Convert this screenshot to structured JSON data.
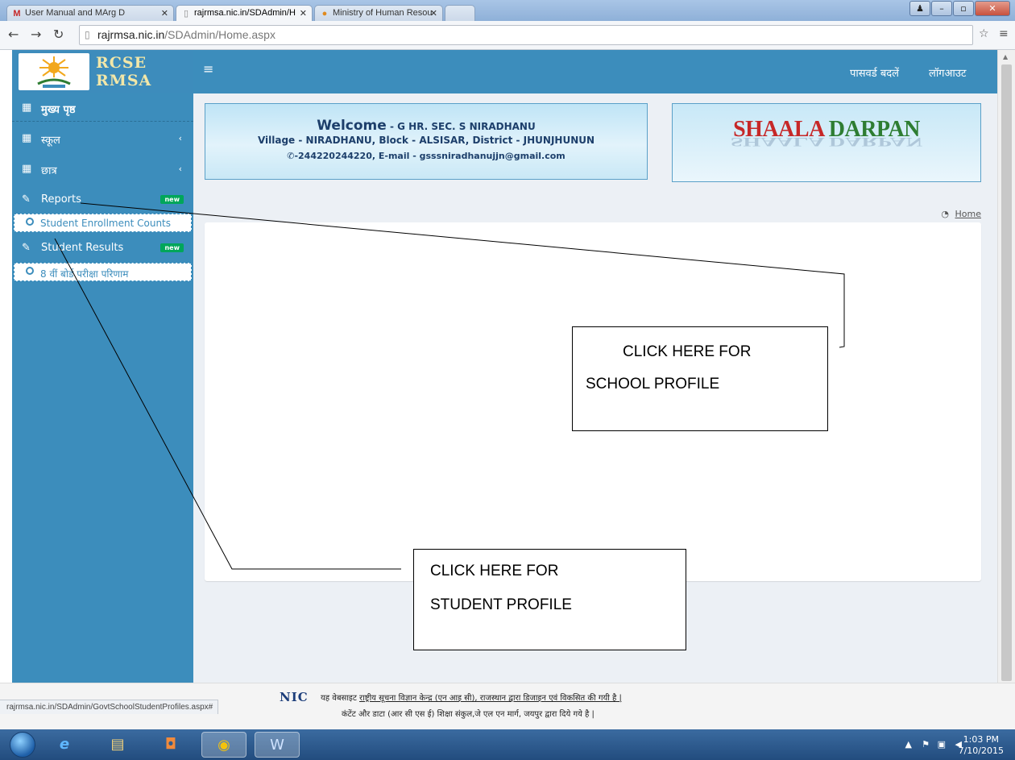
{
  "browser": {
    "tabs": [
      {
        "title": "User Manual and MArg D"
      },
      {
        "title": "rajrmsa.nic.in/SDAdmin/H"
      },
      {
        "title": "Ministry of Human Resou"
      }
    ],
    "url_host": "rajrmsa.nic.in",
    "url_path": "/SDAdmin/Home.aspx",
    "status_url": "rajrmsa.nic.in/SDAdmin/GovtSchoolStudentProfiles.aspx#"
  },
  "logo": {
    "line1": "RCSE",
    "line2": "RMSA"
  },
  "header": {
    "change_password": "पासवर्ड बदलें",
    "logout": "लॉगआउट"
  },
  "sidebar": {
    "items": [
      {
        "label": "मुख्य पृष्ठ"
      },
      {
        "label": "स्कूल"
      },
      {
        "label": "छात्र"
      },
      {
        "label": "Reports",
        "badge": "new"
      },
      {
        "label": "Student Enrollment Counts"
      },
      {
        "label": "Student Results",
        "badge": "new"
      },
      {
        "label": "8 वीं बोर्ड परीक्षा परिणाम"
      }
    ]
  },
  "welcome": {
    "prefix": "Welcome",
    "school": " - G HR. SEC. S NIRADHANU",
    "address": "Village - NIRADHANU, Block - ALSISAR, District - JHUNJHUNUN",
    "contact": "-244220244220,  E-mail - gsssniradhanujjn@gmail.com"
  },
  "banner": {
    "word1": "SHAALA",
    "word2": "DARPAN"
  },
  "breadcrumb": {
    "home": "Home"
  },
  "annotations": {
    "school_line1": "CLICK HERE FOR",
    "school_line2": "SCHOOL PROFILE",
    "student_line1": "CLICK HERE FOR",
    "student_line2": "STUDENT PROFILE"
  },
  "footer": {
    "nic": "NIC",
    "line1_prefix": "यह वेबसाइट ",
    "line1_link": "राष्ट्रीय सूचना विज्ञान केन्द्र (एन आइ सी), राजस्थान द्वारा डिजाइन एवं विकसित की गयी है |",
    "line2": "कंटेंट और डाटा (आर सी एस ई) शिक्षा संकुल,जे एल एन मार्ग, जयपुर द्वारा दिये गये है |"
  },
  "taskbar": {
    "time": "1:03 PM",
    "date": "7/10/2015"
  }
}
